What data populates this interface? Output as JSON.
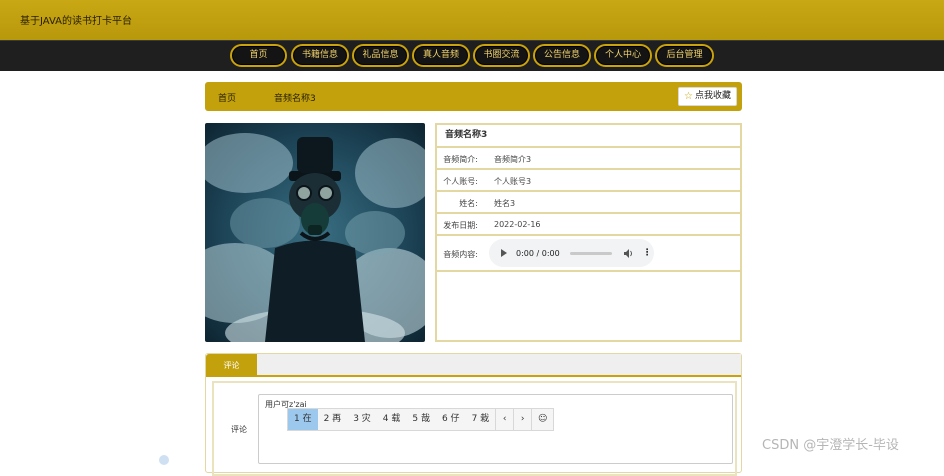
{
  "site": {
    "title": "基于JAVA的读书打卡平台"
  },
  "nav": {
    "items": [
      {
        "label": "首页"
      },
      {
        "label": "书籍信息"
      },
      {
        "label": "礼品信息"
      },
      {
        "label": "真人音频"
      },
      {
        "label": "书圈交流"
      },
      {
        "label": "公告信息"
      },
      {
        "label": "个人中心"
      },
      {
        "label": "后台管理"
      }
    ]
  },
  "breadcrumb": {
    "home": "首页",
    "current": "音频名称3",
    "favorite_label": "点我收藏"
  },
  "detail": {
    "title": "音频名称3",
    "rows": [
      {
        "label": "音频简介:",
        "value": "音频简介3"
      },
      {
        "label": "个人账号:",
        "value": "个人账号3"
      },
      {
        "label": "姓名:",
        "value": "姓名3"
      },
      {
        "label": "发布日期:",
        "value": "2022-02-16"
      }
    ],
    "audio": {
      "label": "音频内容:",
      "time": "0:00 / 0:00"
    }
  },
  "comments": {
    "tab_label": "评论",
    "field_label": "评论",
    "input_value": "用户可z'zai",
    "ime_candidates": [
      "1 在",
      "2 再",
      "3 灾",
      "4 载",
      "5 哉",
      "6 仔",
      "7 栽"
    ]
  },
  "watermark": "CSDN @宇澄学长-毕设",
  "colors": {
    "gold": "#c2a10d",
    "nav_bg": "#1f1f1f",
    "border": "#e3d7a2"
  }
}
